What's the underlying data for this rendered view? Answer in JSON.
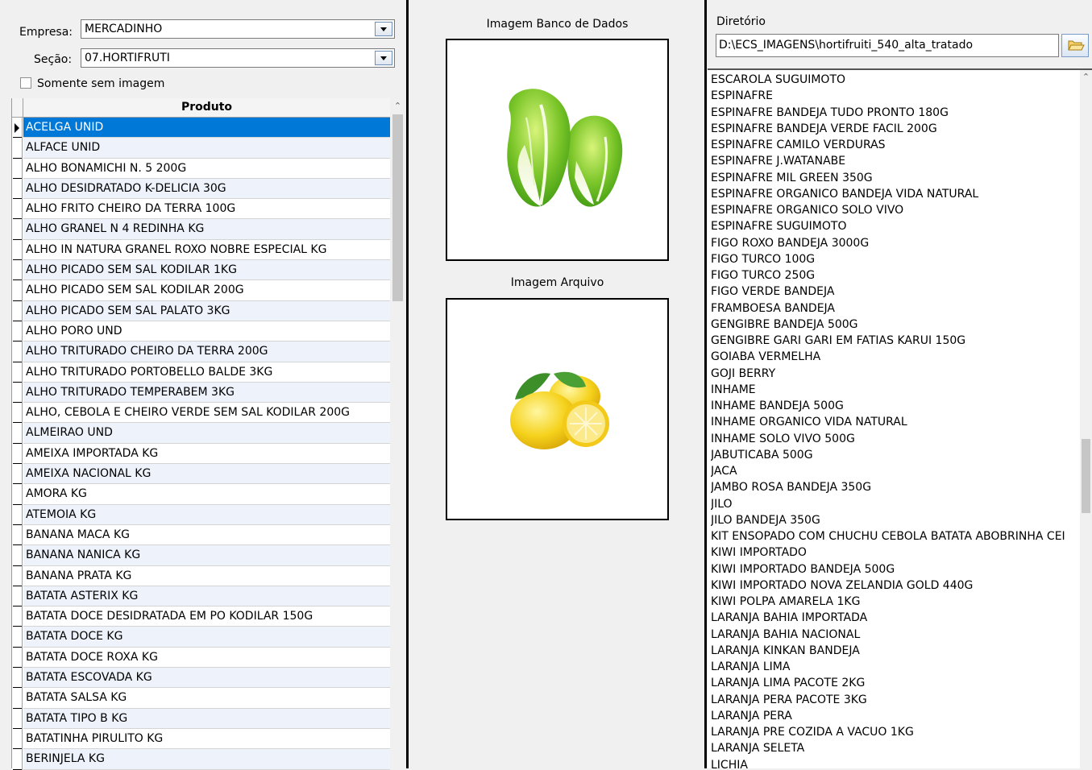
{
  "filters": {
    "empresa_label": "Empresa:",
    "empresa_value": "MERCADINHO",
    "secao_label": "Seção:",
    "secao_value": "07.HORTIFRUTI",
    "somente_label": "Somente sem imagem",
    "somente_checked": false
  },
  "grid": {
    "column_header": "Produto",
    "rows": [
      "ACELGA UNID",
      "ALFACE UNID",
      "ALHO BONAMICHI N. 5 200G",
      "ALHO DESIDRATADO K-DELICIA 30G",
      "ALHO FRITO CHEIRO DA TERRA 100G",
      "ALHO GRANEL N 4 REDINHA KG",
      "ALHO IN NATURA GRANEL ROXO NOBRE ESPECIAL KG",
      "ALHO PICADO SEM SAL KODILAR 1KG",
      "ALHO PICADO SEM SAL KODILAR 200G",
      "ALHO PICADO SEM SAL PALATO 3KG",
      "ALHO PORO UND",
      "ALHO TRITURADO CHEIRO DA TERRA 200G",
      "ALHO TRITURADO PORTOBELLO BALDE 3KG",
      "ALHO TRITURADO TEMPERABEM 3KG",
      "ALHO, CEBOLA E CHEIRO VERDE SEM SAL KODILAR 200G",
      "ALMEIRAO UND",
      "AMEIXA IMPORTADA KG",
      "AMEIXA NACIONAL KG",
      "AMORA KG",
      "ATEMOIA KG",
      "BANANA MACA KG",
      "BANANA NANICA KG",
      "BANANA PRATA KG",
      "BATATA ASTERIX KG",
      "BATATA DOCE DESIDRATADA EM PO KODILAR 150G",
      "BATATA DOCE KG",
      "BATATA DOCE ROXA KG",
      "BATATA ESCOVADA KG",
      "BATATA SALSA KG",
      "BATATA TIPO B KG",
      "BATATINHA PIRULITO KG",
      "BERINJELA KG"
    ],
    "selected_index": 0
  },
  "images": {
    "db_caption": "Imagem Banco de Dados",
    "file_caption": "Imagem Arquivo",
    "db_image_icon": "napa-cabbage-picture",
    "file_image_icon": "lemon-picture"
  },
  "directory": {
    "label": "Diretório",
    "path": "D:\\ECS_IMAGENS\\hortifruiti_540_alta_tratado",
    "browse_icon": "folder-icon"
  },
  "file_list": [
    "ESCAROLA SUGUIMOTO",
    "ESPINAFRE",
    "ESPINAFRE BANDEJA TUDO PRONTO 180G",
    "ESPINAFRE BANDEJA VERDE FACIL 200G",
    "ESPINAFRE CAMILO VERDURAS",
    "ESPINAFRE J.WATANABE",
    "ESPINAFRE MIL GREEN 350G",
    "ESPINAFRE ORGANICO BANDEJA VIDA NATURAL",
    "ESPINAFRE ORGANICO SOLO VIVO",
    "ESPINAFRE SUGUIMOTO",
    "FIGO ROXO BANDEJA 3000G",
    "FIGO TURCO 100G",
    "FIGO TURCO 250G",
    "FIGO VERDE BANDEJA",
    "FRAMBOESA BANDEJA",
    "GENGIBRE BANDEJA 500G",
    "GENGIBRE GARI GARI EM FATIAS KARUI 150G",
    "GOIABA VERMELHA",
    "GOJI BERRY",
    "INHAME",
    "INHAME BANDEJA 500G",
    "INHAME ORGANICO VIDA NATURAL",
    "INHAME SOLO VIVO 500G",
    "JABUTICABA 500G",
    "JACA",
    "JAMBO ROSA BANDEJA 350G",
    "JILO",
    "JILO BANDEJA 350G",
    "KIT ENSOPADO COM CHUCHU CEBOLA BATATA ABOBRINHA CEI",
    "KIWI IMPORTADO",
    "KIWI IMPORTADO BANDEJA 500G",
    "KIWI IMPORTADO NOVA ZELANDIA GOLD 440G",
    "KIWI POLPA AMARELA 1KG",
    "LARANJA BAHIA IMPORTADA",
    "LARANJA BAHIA NACIONAL",
    "LARANJA KINKAN BANDEJA",
    "LARANJA LIMA",
    "LARANJA LIMA PACOTE 2KG",
    "LARANJA PERA PACOTE 3KG",
    "LARANJA PERA",
    "LARANJA PRE COZIDA A VACUO 1KG",
    "LARANJA SELETA",
    "LICHIA"
  ],
  "colors": {
    "selection": "#0078d7",
    "row_alt": "#eef3fb"
  }
}
